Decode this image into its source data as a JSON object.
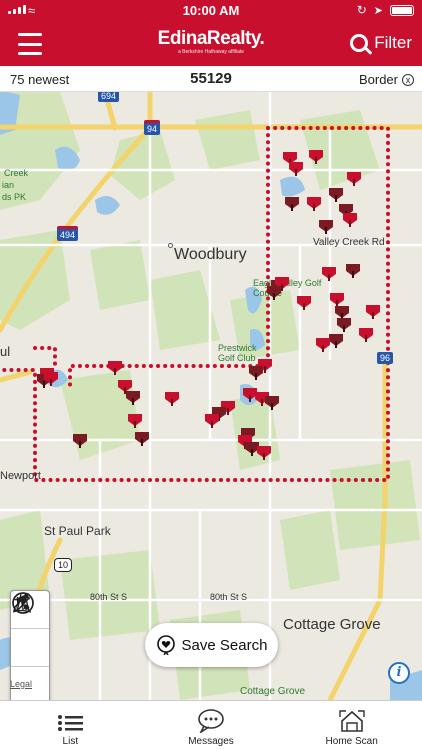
{
  "status": {
    "time": "10:00 AM"
  },
  "nav": {
    "brand": "EdinaRealty.",
    "brand_tagline": "a Berkshire Hathaway affiliate",
    "filter_label": "Filter"
  },
  "info": {
    "left": "75 newest",
    "center": "55129",
    "right": "Border",
    "clear_symbol": "x"
  },
  "map": {
    "labels": {
      "woodbury": "Woodbury",
      "valley_creek": "Valley Creek Rd",
      "eagle_valley": "Eagle Valley Golf Course",
      "prestwick": "Prestwick Golf Club",
      "cottage_grove": "Cottage Grove",
      "cottage_grove_park": "Cottage Grove",
      "st_paul_park": "St Paul Park",
      "newport": "Newport",
      "creek": "Creek",
      "indian": "ian",
      "ds_pk": "ds PK",
      "st_80th": "80th St S",
      "st_80th_2": "80th St S",
      "ul": "ul",
      "shield_494": "494",
      "shield_94": "94",
      "shield_96": "96",
      "shield_10": "10",
      "shield_694": "694",
      "legal": "Legal"
    }
  },
  "save_search_label": "Save Search",
  "tabs": [
    {
      "label": "List",
      "icon": "list-icon"
    },
    {
      "label": "Messages",
      "icon": "messages-icon"
    },
    {
      "label": "Home Scan",
      "icon": "home-scan-icon"
    }
  ],
  "colors": {
    "brand_red": "#c8102e",
    "pin_red": "#c8102e",
    "pin_dark": "#7a1a22",
    "border_dots": "#c8102e",
    "info_blue": "#1e73c9"
  }
}
